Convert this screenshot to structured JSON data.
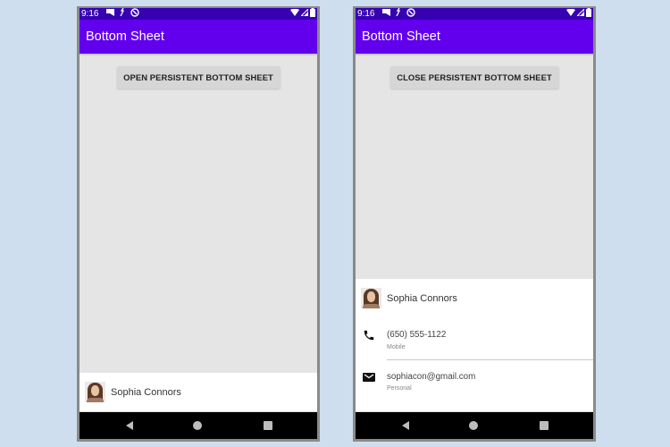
{
  "colors": {
    "status_bar": "#3700B3",
    "app_bar": "#6200EE",
    "background": "#CFDEEE",
    "content": "#E5E5E5",
    "nav_bar": "#000000"
  },
  "screens": [
    {
      "status_bar": {
        "time": "9:16",
        "left_icons": [
          "notification-icon",
          "usb-debug-icon",
          "data-saver-icon"
        ],
        "right_icons": [
          "wifi-icon",
          "signal-icon",
          "battery-icon"
        ]
      },
      "app_bar": {
        "title": "Bottom Sheet"
      },
      "button": {
        "label": "OPEN PERSISTENT BOTTOM SHEET"
      },
      "bottom_sheet": {
        "state": "collapsed",
        "contact_name": "Sophia Connors"
      },
      "nav_bar": {
        "buttons": [
          "back",
          "home",
          "recents"
        ]
      }
    },
    {
      "status_bar": {
        "time": "9:16",
        "left_icons": [
          "notification-icon",
          "usb-debug-icon",
          "data-saver-icon"
        ],
        "right_icons": [
          "wifi-icon",
          "signal-icon",
          "battery-icon"
        ]
      },
      "app_bar": {
        "title": "Bottom Sheet"
      },
      "button": {
        "label": "CLOSE PERSISTENT BOTTOM SHEET"
      },
      "bottom_sheet": {
        "state": "expanded",
        "contact_name": "Sophia Connors",
        "phone": {
          "value": "(650) 555-1122",
          "label": "Mobile",
          "icon": "phone-icon"
        },
        "email": {
          "value": "sophiacon@gmail.com",
          "label": "Personal",
          "icon": "email-icon"
        }
      },
      "nav_bar": {
        "buttons": [
          "back",
          "home",
          "recents"
        ]
      }
    }
  ]
}
